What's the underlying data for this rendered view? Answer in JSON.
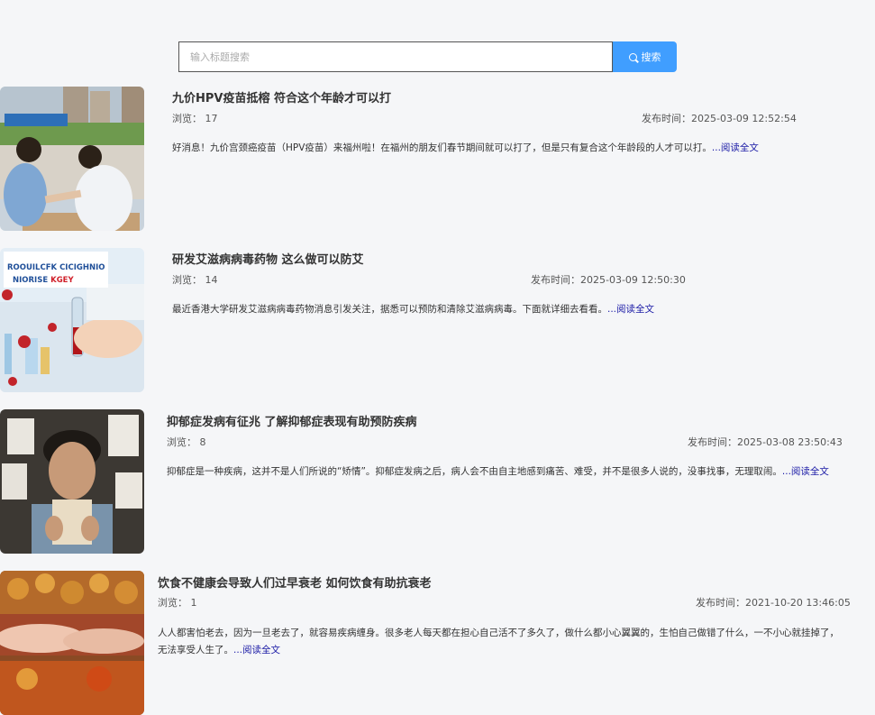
{
  "search": {
    "placeholder": "输入标题搜索",
    "button_label": "搜索"
  },
  "articles": [
    {
      "title": "九价HPV疫苗抵榕 符合这个年龄才可以打",
      "views_label": "浏览：",
      "views": "17",
      "published_label": "发布时间：",
      "published": "2025-03-09 12:52:54",
      "excerpt": "好消息！九价宫颈癌疫苗（HPV疫苗）来福州啦！在福州的朋友们春节期间就可以打了，但是只有复合这个年龄段的人才可以打。",
      "read_more": "...阅读全文",
      "image": "vaccination-photo"
    },
    {
      "title": "研发艾滋病病毒药物 这么做可以防艾",
      "views_label": "浏览：",
      "views": "14",
      "published_label": "发布时间：",
      "published": "2025-03-09 12:50:30",
      "excerpt": "最近香港大学研发艾滋病病毒药物消息引发关注，据悉可以预防和清除艾滋病病毒。下面就详细去看看。",
      "read_more": "...阅读全文",
      "image": "lab-vial-photo",
      "image_sign": "ROOUILCFK CICIGHNIO NIORISE KGEY"
    },
    {
      "title": "抑郁症发病有征兆 了解抑郁症表现有助预防疾病",
      "views_label": "浏览：",
      "views": "8",
      "published_label": "发布时间：",
      "published": "2025-03-08 23:50:43",
      "excerpt": "抑郁症是一种疾病，这并不是人们所说的“矫情”。抑郁症发病之后，病人会不由自主地感到痛苦、难受，并不是很多人说的，没事找事，无理取闹。",
      "read_more": "...阅读全文",
      "image": "worried-man-photo"
    },
    {
      "title": "饮食不健康会导致人们过早衰老 如何饮食有助抗衰老",
      "views_label": "浏览：",
      "views": "1",
      "published_label": "发布时间：",
      "published": "2021-10-20 13:46:05",
      "excerpt": "人人都害怕老去，因为一旦老去了，就容易疾病缠身。很多老人每天都在担心自己活不了多久了，做什么都小心翼翼的，生怕自己做错了什么，一不小心就挂掉了，无法享受人生了。",
      "read_more": "...阅读全文",
      "image": "fried-food-photo"
    }
  ]
}
